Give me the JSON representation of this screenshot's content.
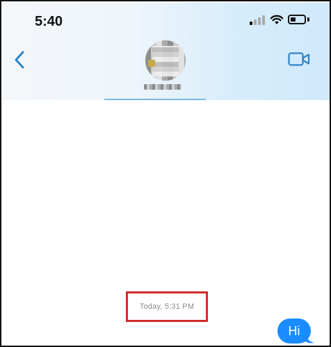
{
  "status_bar": {
    "time": "5:40",
    "signal_icon": "signal-bars-icon",
    "wifi_icon": "wifi-icon",
    "battery_icon": "battery-icon",
    "battery_level": 0.4
  },
  "nav": {
    "back_icon": "chevron-left-icon",
    "video_icon": "video-camera-icon",
    "accent_color": "#2f83c5"
  },
  "conversation": {
    "timestamp": "Today, 5:31 PM",
    "messages": [
      {
        "text": "Hi",
        "from": "me",
        "color": "#1b8cff"
      }
    ]
  },
  "annotation": {
    "highlight_color": "#d22a2a"
  }
}
